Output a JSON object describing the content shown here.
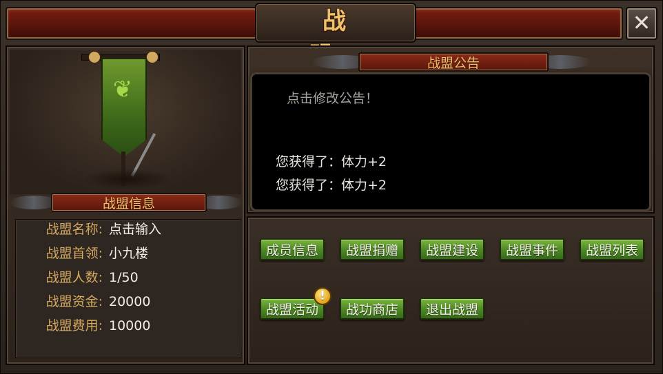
{
  "window": {
    "title": "战　盟",
    "close_icon": "close-x-icon"
  },
  "left": {
    "banner_icon": "guild-banner-icon",
    "section_title": "战盟信息",
    "rows": [
      {
        "label": "战盟名称:",
        "value": "点击输入"
      },
      {
        "label": "战盟首领:",
        "value": "小九楼"
      },
      {
        "label": "战盟人数:",
        "value": "1/50"
      },
      {
        "label": "战盟资金:",
        "value": "20000"
      },
      {
        "label": "战盟费用:",
        "value": "10000"
      }
    ]
  },
  "notice": {
    "title": "战盟公告",
    "hint": "点击修改公告！",
    "lines": [
      "您获得了：体力+2",
      "您获得了：体力+2"
    ]
  },
  "buttons": {
    "row1": [
      "成员信息",
      "战盟捐赠",
      "战盟建设",
      "战盟事件",
      "战盟列表"
    ],
    "row2": [
      "战盟活动",
      "战功商店",
      "退出战盟"
    ],
    "alert_badge": "!"
  },
  "colors": {
    "title_gold": "#f2c16b",
    "header_red": "#8a2a18",
    "button_green": "#4f8a25"
  }
}
